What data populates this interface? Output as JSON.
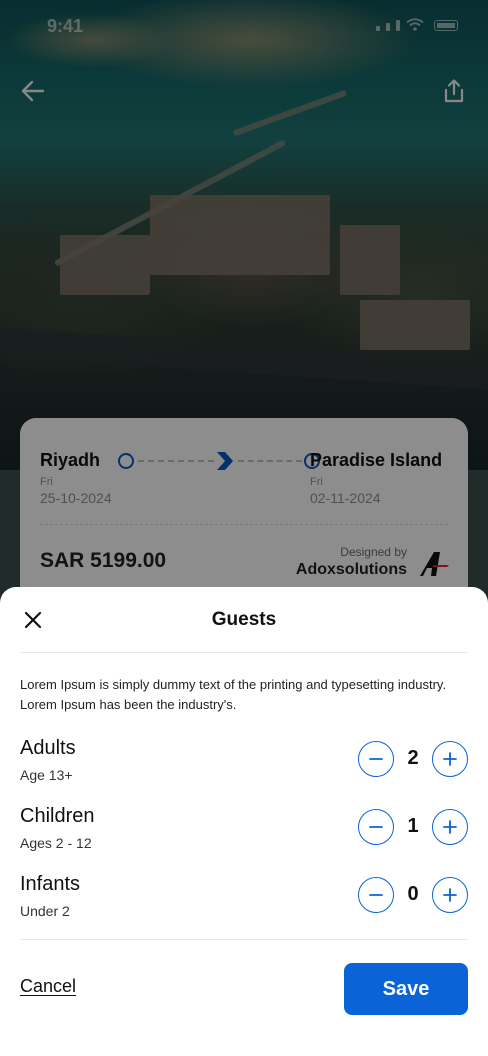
{
  "status_bar": {
    "time": "9:41"
  },
  "hero": {
    "back_icon": "arrow-left-icon",
    "share_icon": "share-icon"
  },
  "trip": {
    "origin": {
      "city": "Riyadh",
      "day": "Fri",
      "date": "25-10-2024"
    },
    "destination": {
      "city": "Paradise Island",
      "day": "Fri",
      "date": "02-11-2024"
    },
    "price": "SAR 5199.00",
    "designed_by": "Designed by",
    "brand": "Adoxsolutions"
  },
  "sheet": {
    "title": "Guests",
    "close_icon": "close-icon",
    "description": "Lorem Ipsum is simply dummy text of the printing and typesetting industry. Lorem Ipsum has been the industry's.",
    "guests": [
      {
        "label": "Adults",
        "sublabel": "Age 13+",
        "count": "2"
      },
      {
        "label": "Children",
        "sublabel": "Ages 2 - 12",
        "count": "1"
      },
      {
        "label": "Infants",
        "sublabel": "Under 2",
        "count": "0"
      }
    ],
    "cancel_label": "Cancel",
    "save_label": "Save"
  },
  "colors": {
    "accent": "#0b63d8",
    "route_ring": "#0a55b8",
    "overlay": "rgba(0,0,0,0.42)"
  }
}
